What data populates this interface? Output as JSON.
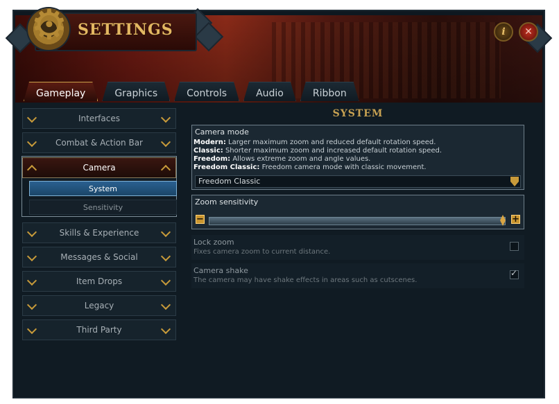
{
  "window": {
    "title": "SETTINGS"
  },
  "tabs": [
    {
      "label": "Gameplay",
      "active": true
    },
    {
      "label": "Graphics",
      "active": false
    },
    {
      "label": "Controls",
      "active": false
    },
    {
      "label": "Audio",
      "active": false
    },
    {
      "label": "Ribbon",
      "active": false
    }
  ],
  "sidebar": {
    "items": [
      {
        "label": "Interfaces"
      },
      {
        "label": "Combat & Action Bar"
      },
      {
        "label": "Camera"
      },
      {
        "label": "Skills & Experience"
      },
      {
        "label": "Messages & Social"
      },
      {
        "label": "Item Drops"
      },
      {
        "label": "Legacy"
      },
      {
        "label": "Third Party"
      }
    ],
    "camera_sub": [
      {
        "label": "System",
        "selected": true
      },
      {
        "label": "Sensitivity",
        "selected": false
      }
    ]
  },
  "section": {
    "title": "SYSTEM"
  },
  "camera_mode": {
    "label": "Camera mode",
    "lines": [
      {
        "term": "Modern:",
        "text": " Larger maximum zoom and reduced default rotation speed."
      },
      {
        "term": "Classic:",
        "text": " Shorter maximum zoom and increased default rotation speed."
      },
      {
        "term": "Freedom:",
        "text": " Allows extreme zoom and angle values."
      },
      {
        "term": "Freedom Classic:",
        "text": " Freedom camera mode with classic movement."
      }
    ],
    "selected": "Freedom Classic"
  },
  "zoom_sensitivity": {
    "label": "Zoom sensitivity",
    "value_fraction": 1.0
  },
  "lock_zoom": {
    "label": "Lock zoom",
    "desc": "Fixes camera zoom to current distance.",
    "checked": false
  },
  "camera_shake": {
    "label": "Camera shake",
    "desc": "The camera may have shake effects in areas such as cutscenes.",
    "checked": true
  },
  "colors": {
    "accent": "#c8a252",
    "active_tab": "#5b1c12",
    "selected_item": "#2a6090"
  },
  "icons": {
    "logo": "gear-icon",
    "info": "info-icon",
    "close": "close-icon"
  }
}
